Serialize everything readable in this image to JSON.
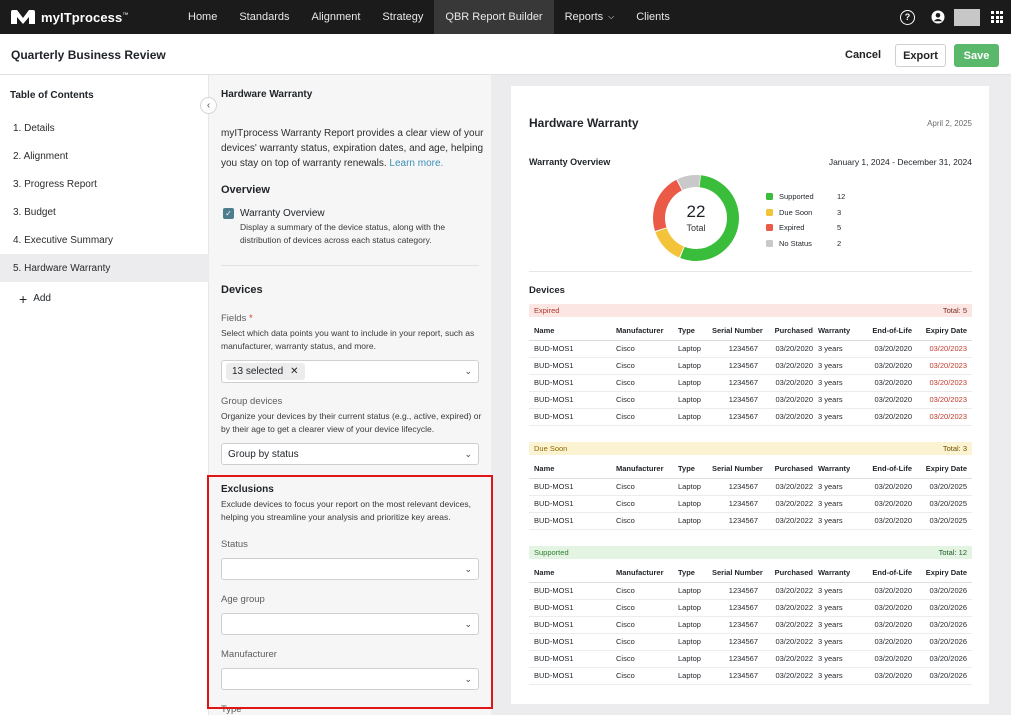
{
  "brand": {
    "name": "myITprocess",
    "tm": "™"
  },
  "nav": {
    "items": [
      {
        "label": "Home"
      },
      {
        "label": "Standards"
      },
      {
        "label": "Alignment"
      },
      {
        "label": "Strategy"
      },
      {
        "label": "QBR Report Builder",
        "active": true
      },
      {
        "label": "Reports",
        "dropdown": true
      },
      {
        "label": "Clients"
      }
    ],
    "help_glyph": "?"
  },
  "header": {
    "title": "Quarterly Business Review",
    "cancel": "Cancel",
    "export": "Export",
    "save": "Save"
  },
  "toc": {
    "title": "Table of Contents",
    "items": [
      {
        "label": "1. Details"
      },
      {
        "label": "2. Alignment"
      },
      {
        "label": "3. Progress Report"
      },
      {
        "label": "3. Budget"
      },
      {
        "label": "4. Executive Summary"
      },
      {
        "label": "5. Hardware Warranty",
        "active": true
      }
    ],
    "add": "Add"
  },
  "settings": {
    "heading": "Hardware Warranty",
    "intro_line1": "myITprocess Warranty Report provides a clear view of your",
    "intro_line2": "devices' warranty status, expiration dates, and age, helping",
    "intro_line3": "you stay on top of warranty renewals.",
    "learn_more": "Learn more.",
    "overview": {
      "title": "Overview",
      "checkbox_label": "Warranty Overview",
      "checked": true,
      "desc_line1": "Display a summary of the device status, along with the",
      "desc_line2": "distribution of devices across each status category."
    },
    "devices": {
      "title": "Devices",
      "fields_label": "Fields",
      "required_mark": "*",
      "fields_desc_line1": "Select which data points you want to include in your report, such as",
      "fields_desc_line2": "manufacturer, warranty status, and more.",
      "fields_chip": "13 selected",
      "group_label": "Group devices",
      "group_desc_line1": "Organize your devices by their current status (e.g., active, expired) or",
      "group_desc_line2": "by their age to get a clearer view of your device lifecycle.",
      "group_value": "Group by status"
    },
    "exclusions": {
      "title": "Exclusions",
      "desc_line1": "Exclude devices to focus your report on the most relevant devices,",
      "desc_line2": "helping you streamline your analysis and prioritize key areas.",
      "status_label": "Status",
      "age_label": "Age group",
      "manufacturer_label": "Manufacturer",
      "type_label": "Type"
    }
  },
  "preview": {
    "title": "Hardware Warranty",
    "date": "April 2, 2025",
    "overview_title": "Warranty Overview",
    "range": "January 1, 2024 - December 31, 2024",
    "total_value": "22",
    "total_label": "Total",
    "legend": [
      {
        "name": "Supported",
        "value": 12,
        "color": "#3bbd3c"
      },
      {
        "name": "Due Soon",
        "value": 3,
        "color": "#f3c43a"
      },
      {
        "name": "Expired",
        "value": 5,
        "color": "#ea5a47"
      },
      {
        "name": "No Status",
        "value": 2,
        "color": "#c9c9c9"
      }
    ],
    "devices_title": "Devices",
    "columns": [
      "Name",
      "Manufacturer",
      "Type",
      "Serial Number",
      "Purchased",
      "Warranty",
      "End-of-Life",
      "Expiry Date"
    ],
    "groups": [
      {
        "name": "Expired",
        "total": "Total: 5",
        "rows": [
          [
            "BUD-MOS1",
            "Cisco",
            "Laptop",
            "1234567",
            "03/20/2020",
            "3 years",
            "03/20/2020",
            "03/20/2023"
          ],
          [
            "BUD-MOS1",
            "Cisco",
            "Laptop",
            "1234567",
            "03/20/2020",
            "3 years",
            "03/20/2020",
            "03/20/2023"
          ],
          [
            "BUD-MOS1",
            "Cisco",
            "Laptop",
            "1234567",
            "03/20/2020",
            "3 years",
            "03/20/2020",
            "03/20/2023"
          ],
          [
            "BUD-MOS1",
            "Cisco",
            "Laptop",
            "1234567",
            "03/20/2020",
            "3 years",
            "03/20/2020",
            "03/20/2023"
          ],
          [
            "BUD-MOS1",
            "Cisco",
            "Laptop",
            "1234567",
            "03/20/2020",
            "3 years",
            "03/20/2020",
            "03/20/2023"
          ]
        ]
      },
      {
        "name": "Due Soon",
        "total": "Total: 3",
        "rows": [
          [
            "BUD-MOS1",
            "Cisco",
            "Laptop",
            "1234567",
            "03/20/2022",
            "3 years",
            "03/20/2020",
            "03/20/2025"
          ],
          [
            "BUD-MOS1",
            "Cisco",
            "Laptop",
            "1234567",
            "03/20/2022",
            "3 years",
            "03/20/2020",
            "03/20/2025"
          ],
          [
            "BUD-MOS1",
            "Cisco",
            "Laptop",
            "1234567",
            "03/20/2022",
            "3 years",
            "03/20/2020",
            "03/20/2025"
          ]
        ]
      },
      {
        "name": "Supported",
        "total": "Total: 12",
        "rows": [
          [
            "BUD-MOS1",
            "Cisco",
            "Laptop",
            "1234567",
            "03/20/2022",
            "3 years",
            "03/20/2020",
            "03/20/2026"
          ],
          [
            "BUD-MOS1",
            "Cisco",
            "Laptop",
            "1234567",
            "03/20/2022",
            "3 years",
            "03/20/2020",
            "03/20/2026"
          ],
          [
            "BUD-MOS1",
            "Cisco",
            "Laptop",
            "1234567",
            "03/20/2022",
            "3 years",
            "03/20/2020",
            "03/20/2026"
          ],
          [
            "BUD-MOS1",
            "Cisco",
            "Laptop",
            "1234567",
            "03/20/2022",
            "3 years",
            "03/20/2020",
            "03/20/2026"
          ],
          [
            "BUD-MOS1",
            "Cisco",
            "Laptop",
            "1234567",
            "03/20/2022",
            "3 years",
            "03/20/2020",
            "03/20/2026"
          ],
          [
            "BUD-MOS1",
            "Cisco",
            "Laptop",
            "1234567",
            "03/20/2022",
            "3 years",
            "03/20/2020",
            "03/20/2026"
          ]
        ]
      }
    ]
  },
  "colors": {
    "nav_bg": "#1b1b1b",
    "save_green": "#59b86a",
    "expired_red": "#c0392b",
    "highlight_red": "#e01515"
  }
}
